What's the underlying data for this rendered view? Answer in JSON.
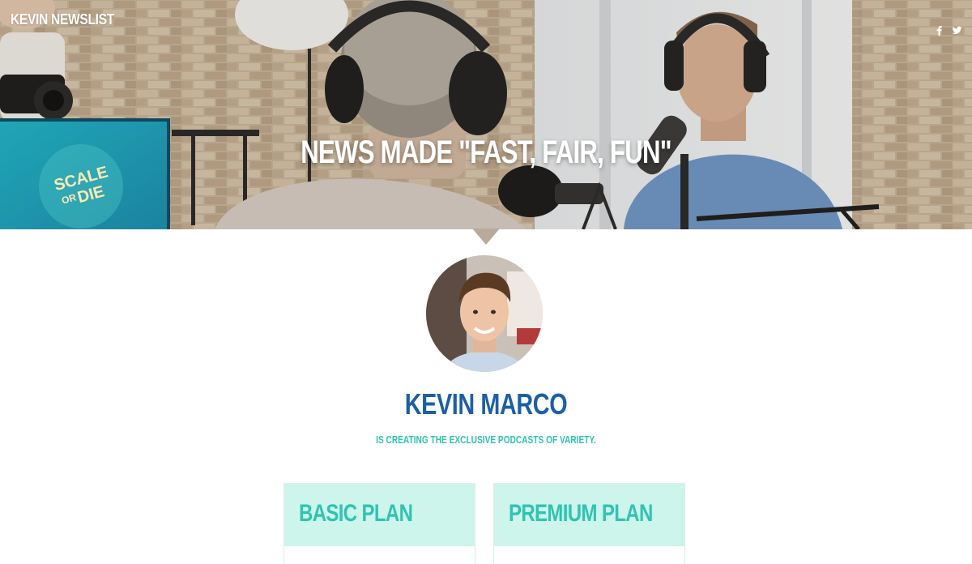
{
  "header": {
    "brand": "KEVIN NEWSLIST",
    "social_icons": [
      "facebook-icon",
      "twitter-icon"
    ]
  },
  "hero": {
    "tagline": "NEWS MADE \"FAST, FAIR, FUN\"",
    "monitor_text_line1": "SCALE",
    "monitor_text_line2": "OR",
    "monitor_text_line3": "DIE"
  },
  "profile": {
    "name": "KEVIN MARCO",
    "subtitle": "IS CREATING THE EXCLUSIVE PODCASTS OF VARIETY."
  },
  "plans": [
    {
      "title": "BASIC PLAN"
    },
    {
      "title": "PREMIUM PLAN"
    }
  ],
  "colors": {
    "name_blue": "#1c5fa8",
    "accent_teal": "#2fc4b2",
    "plan_header_bg": "#cdf5ec"
  }
}
